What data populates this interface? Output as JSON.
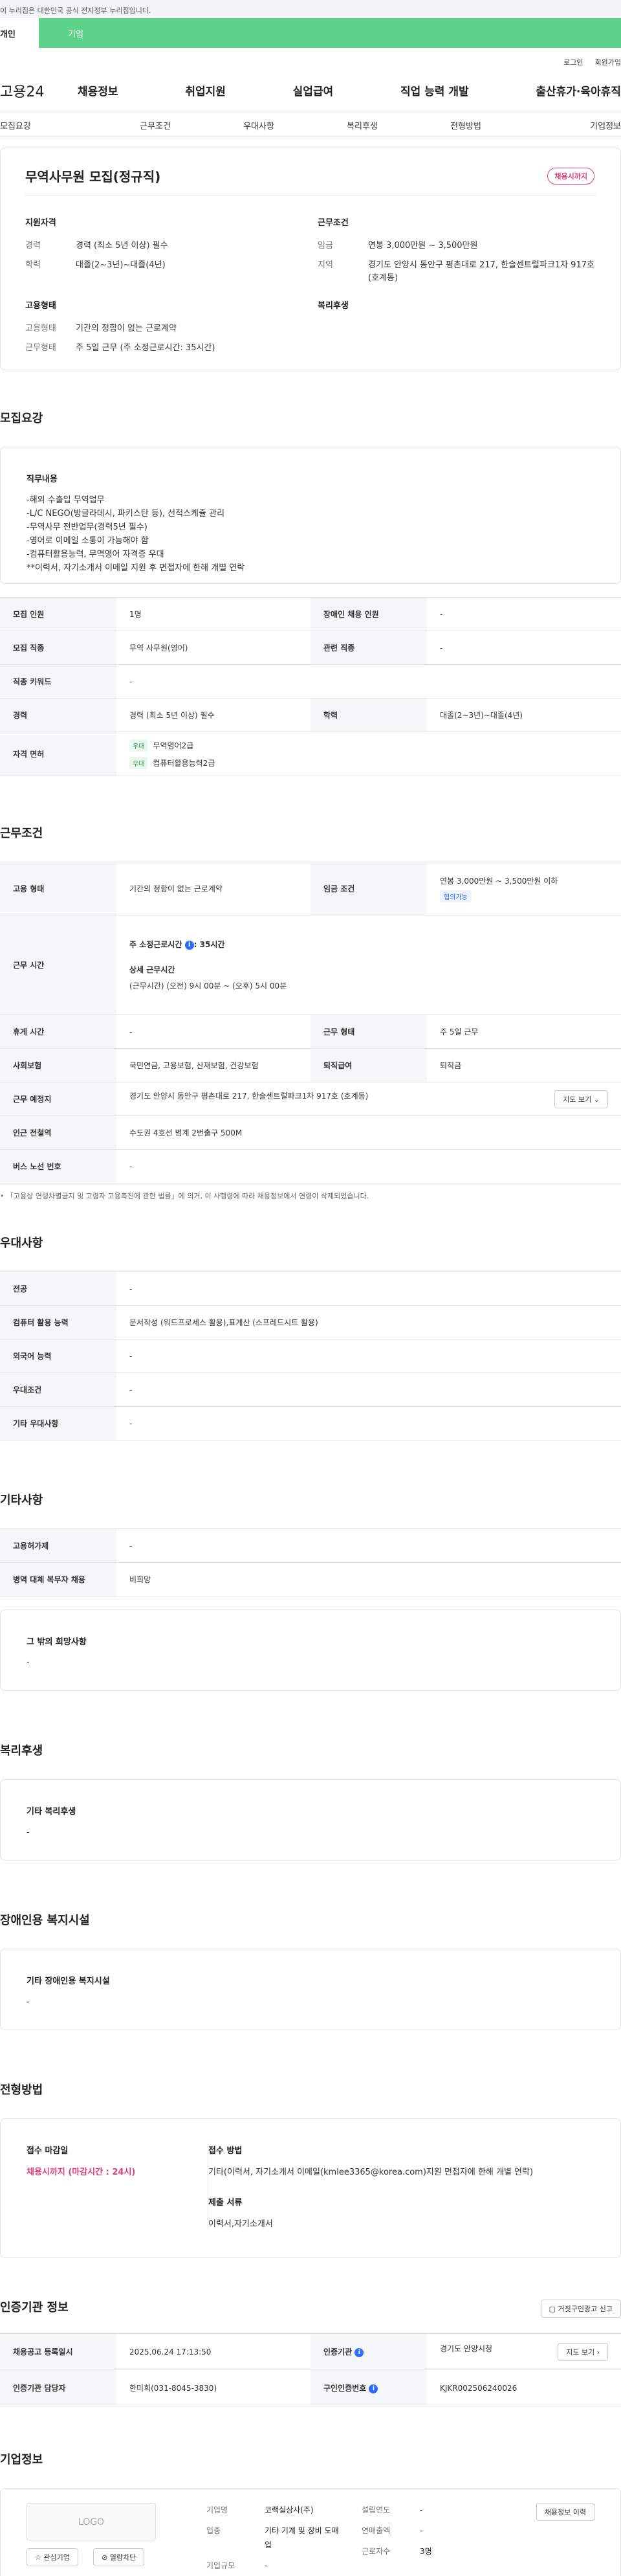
{
  "gov_banner": "이 누리집은 대한민국 공식 전자정부 누리집입니다.",
  "top_tabs": {
    "person": "개인",
    "business": "기업"
  },
  "util": {
    "login": "로그인",
    "join": "회원가입"
  },
  "gnb": {
    "logo": "고용24",
    "menu": [
      "채용정보",
      "취업지원",
      "실업급여",
      "직업 능력 개발",
      "출산휴가·육아휴직"
    ]
  },
  "anchors": [
    "모집요강",
    "근무조건",
    "우대사항",
    "복리후생",
    "전형방법",
    "기업정보"
  ],
  "summary": {
    "title": "무역사무원 모집(정규직)",
    "dday": "채용시까지",
    "applicant_heading": "지원자격",
    "career_label": "경력",
    "career_value": "경력 (최소 5년 이상) 필수",
    "edu_label": "학력",
    "edu_value": "대졸(2~3년)~대졸(4년)",
    "work_heading": "근무조건",
    "wage_label": "임금",
    "wage_value": "연봉 3,000만원 ~ 3,500만원",
    "region_label": "지역",
    "region_value": "경기도 안양시 동안구 평촌대로 217, 한솔센트럴파크1차 917호 (호계동)",
    "emp_heading": "고용형태",
    "emp_label": "고용형태",
    "emp_value": "기간의 정함이 없는 근로계약",
    "hours_label": "근무형태",
    "hours_value": "주 5일 근무 (주 소정근로시간: 35시간)",
    "welfare_heading": "복리후생"
  },
  "recruit": {
    "heading": "모집요강",
    "duty_heading": "직무내용",
    "duty_text": "-해외 수출입 무역업무\n-L/C NEGO(방글라데시, 파키스탄 등), 선적스케쥴 관리\n-무역사무 전반업무(경력5년 필수)\n-영어로 이메일 소통이 가능해야 함\n-컴퓨터활용능력, 무역영어 자격증 우대\n**이력서, 자기소개서 이메일 지원 후 면접자에 한해 개별 연락",
    "rows": {
      "count_label": "모집 인원",
      "count_value": "1명",
      "disabled_label": "장애인 채용 인원",
      "disabled_value": "-",
      "job_label": "모집 직종",
      "job_value": "무역 사무원(영어)",
      "related_label": "관련 직종",
      "related_value": "-",
      "keyword_label": "직종 키워드",
      "keyword_value": "-",
      "career_label": "경력",
      "career_value": "경력 (최소 5년 이상) 필수",
      "edu_label": "학력",
      "edu_value": "대졸(2~3년)~대졸(4년)",
      "license_label": "자격 면허",
      "license_badge": "우대",
      "license_1": "무역영어2급",
      "license_2": "컴퓨터활용능력2급"
    }
  },
  "conditions": {
    "heading": "근무조건",
    "emp_label": "고용 형태",
    "emp_value": "기간의 정함이 없는 근로계약",
    "wage_label": "임금 조건",
    "wage_value": "연봉 3,000만원 ~ 3,500만원 이하",
    "wage_badge": "협의가능",
    "hours_label": "근무 시간",
    "hours_weekly": "주 소정근로시간",
    "hours_weekly_value": ": 35시간",
    "hours_detail_label": "상세 근무시간",
    "hours_detail_value": "(근무시간) (오전) 9시 00분 ~ (오후) 5시 00분",
    "rest_label": "휴게 시간",
    "rest_value": "-",
    "form_label": "근무 형태",
    "form_value": "주 5일 근무",
    "insurance_label": "사회보험",
    "insurance_value": "국민연금, 고용보험, 산재보험, 건강보험",
    "retire_label": "퇴직급여",
    "retire_value": "퇴직금",
    "place_label": "근무 예정지",
    "place_value": "경기도 안양시 동안구 평촌대로 217, 한솔센트럴파크1차 917호 (호계동)",
    "map_button": "지도 보기",
    "subway_label": "인근 전철역",
    "subway_value": "수도권 4호선 범계 2번출구 500M",
    "bus_label": "버스 노선 번호",
    "bus_value": "-",
    "note": "「고용상 연령차별금지 및 고령자 고용촉진에 관한 법률」에 의거, 이 사행령에 따라 채용정보에서 연령이 삭제되었습니다."
  },
  "preference": {
    "heading": "우대사항",
    "major_label": "전공",
    "major_value": "-",
    "computer_label": "컴퓨터 활용 능력",
    "computer_value": "문서작성 (워드프로세스 활용),표계산 (스프레드시트 활용)",
    "lang_label": "외국어 능력",
    "lang_value": "-",
    "cond_label": "우대조건",
    "cond_value": "-",
    "etc_label": "기타 우대사항",
    "etc_value": "-"
  },
  "etc": {
    "heading": "기타사항",
    "hire_label": "고용허가제",
    "hire_value": "-",
    "military_label": "병역 대체 복무자 채용",
    "military_value": "비희망",
    "other_heading": "그 밖의 희망사항",
    "other_value": "-"
  },
  "welfare": {
    "heading": "복리후생",
    "sub": "기타 복리후생",
    "value": "-"
  },
  "facility": {
    "heading": "장애인용 복지시설",
    "sub": "기타 장애인용 복지시설",
    "value": "-"
  },
  "selection": {
    "heading": "전형방법",
    "deadline_label": "접수 마감일",
    "deadline_value": "채용시까지 (마감시간 : 24시)",
    "method_label": "접수 방법",
    "method_value": "기타(이력서, 자기소개서 이메일(kmlee3365@korea.com)지원 면접자에 한해 개별 연락)",
    "docs_label": "제출 서류",
    "docs_value": "이력서,자기소개서"
  },
  "agency": {
    "heading": "인증기관 정보",
    "report_button": "거짓구인광고 신고",
    "date_label": "채용공고 등록일시",
    "date_value": "2025.06.24 17:13:50",
    "agency_label": "인증기관",
    "agency_value": "경기도 안양시청",
    "map_button": "지도 보기",
    "manager_label": "인증기관 담당자",
    "manager_value": "한미희(031-8045-3830)",
    "cert_label": "구인인증번호",
    "cert_value": "KJKR002506240026"
  },
  "company": {
    "heading": "기업정보",
    "logo": "LOGO",
    "fav_button": "관심기업",
    "block_button": "열람차단",
    "name_label": "기업명",
    "name_value": "코랙실상사(주)",
    "industry_label": "업종",
    "industry_value": "기타 기계 및 장비 도매업",
    "size_label": "기업규모",
    "size_value": "-",
    "year_label": "설립연도",
    "year_value": "-",
    "sales_label": "연매출액",
    "sales_value": "-",
    "emp_label": "근로자수",
    "emp_value": "3명",
    "history_button": "채용정보 이력"
  }
}
